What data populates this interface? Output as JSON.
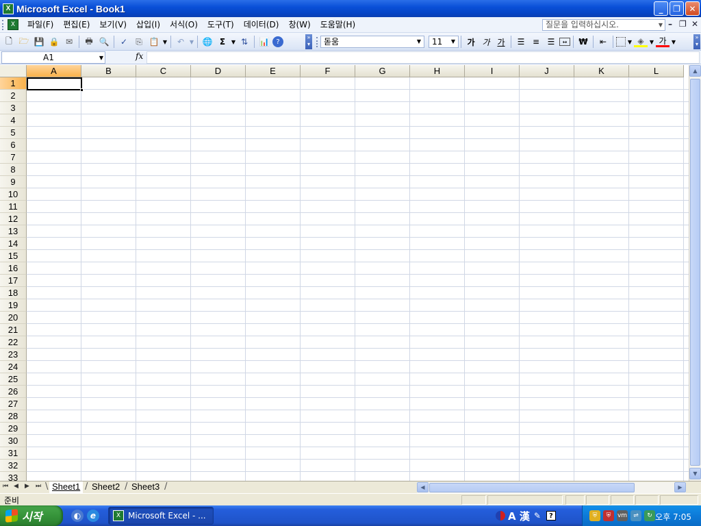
{
  "window": {
    "title": "Microsoft Excel - Book1"
  },
  "menubar": {
    "items": [
      "파일(F)",
      "편집(E)",
      "보기(V)",
      "삽입(I)",
      "서식(O)",
      "도구(T)",
      "데이터(D)",
      "창(W)",
      "도움말(H)"
    ],
    "help_placeholder": "질문을 입력하십시오."
  },
  "toolbar": {
    "font_name": "돋움",
    "font_size": "11",
    "bold": "가",
    "italic": "가",
    "underline": "가",
    "currency": "₩",
    "font_color_label": "가"
  },
  "formula": {
    "name_box": "A1",
    "fx": "fx",
    "content": ""
  },
  "grid": {
    "columns": [
      "A",
      "B",
      "C",
      "D",
      "E",
      "F",
      "G",
      "H",
      "I",
      "J",
      "K",
      "L"
    ],
    "rows": [
      "1",
      "2",
      "3",
      "4",
      "5",
      "6",
      "7",
      "8",
      "9",
      "10",
      "11",
      "12",
      "13",
      "14",
      "15",
      "16",
      "17",
      "18",
      "19",
      "20",
      "21",
      "22",
      "23",
      "24",
      "25",
      "26",
      "27",
      "28",
      "29",
      "30",
      "31",
      "32",
      "33"
    ],
    "selected_col": "A",
    "selected_row": "1"
  },
  "sheets": {
    "tabs": [
      "Sheet1",
      "Sheet2",
      "Sheet3"
    ],
    "active": "Sheet1"
  },
  "status": {
    "text": "준비"
  },
  "taskbar": {
    "start_label": "시작",
    "task_label": "Microsoft Excel - ...",
    "ime_text": "A 漢",
    "clock": "오후 7:05"
  }
}
